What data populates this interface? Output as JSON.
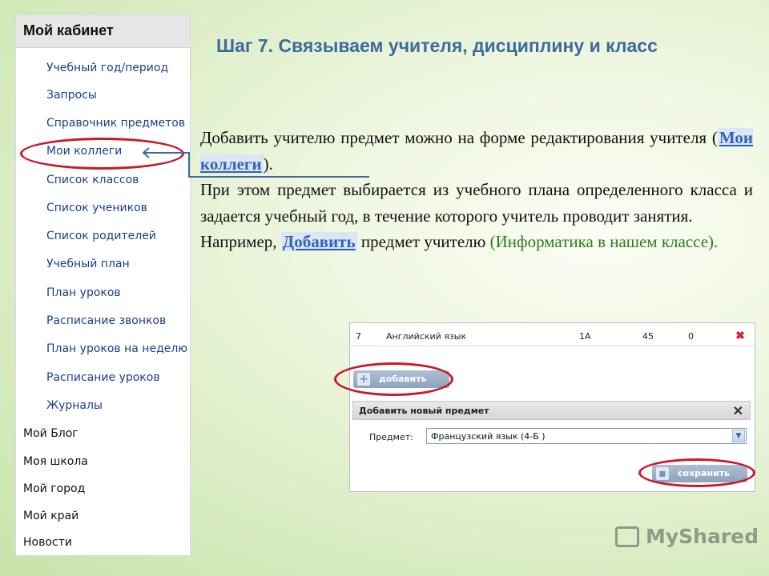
{
  "sidebar": {
    "header": "Мой кабинет",
    "items": [
      {
        "label": "Учебный год/период"
      },
      {
        "label": "Запросы"
      },
      {
        "label": "Справочник предметов"
      },
      {
        "label": "Мои коллеги"
      },
      {
        "label": "Список классов"
      },
      {
        "label": "Список учеников"
      },
      {
        "label": "Список родителей"
      },
      {
        "label": "Учебный план"
      },
      {
        "label": "План уроков"
      },
      {
        "label": "Расписание звонков"
      },
      {
        "label": "План уроков на неделю"
      },
      {
        "label": "Расписание уроков"
      },
      {
        "label": "Журналы"
      }
    ],
    "roots": [
      {
        "label": "Мой Блог"
      },
      {
        "label": "Моя школа"
      },
      {
        "label": "Мой город"
      },
      {
        "label": "Мой край"
      },
      {
        "label": "Новости"
      }
    ]
  },
  "title": "Шаг 7. Связываем учителя, дисциплину и класс",
  "body": {
    "p1_before": "Добавить учителю предмет можно на форме редактирования учителя (",
    "p1_link": "Мои коллеги",
    "p1_after": ").",
    "p2": "При этом предмет выбирается из учебного плана определенного класса и задается учебный год, в течение которого учитель проводит занятия.",
    "p3_before": "Например, ",
    "p3_link": "Добавить",
    "p3_middle": " предмет учителю ",
    "p3_green": "(Информатика в нашем классе)",
    "p3_after": "."
  },
  "panel": {
    "row": {
      "num": "7",
      "subject": "Английский язык",
      "class": "1А",
      "hours": "45",
      "extra": "0"
    },
    "add_button": "добавить",
    "dialog_title": "Добавить новый предмет",
    "field_label": "Предмет:",
    "select_value": "Французский язык (4-Б )",
    "save_button": "сохранить"
  },
  "watermark": "MyShared",
  "colors": {
    "accent": "#3d6aa0",
    "highlight_ellipse": "#c8182b",
    "link": "#3560b8",
    "green_text": "#2c7d1c"
  }
}
